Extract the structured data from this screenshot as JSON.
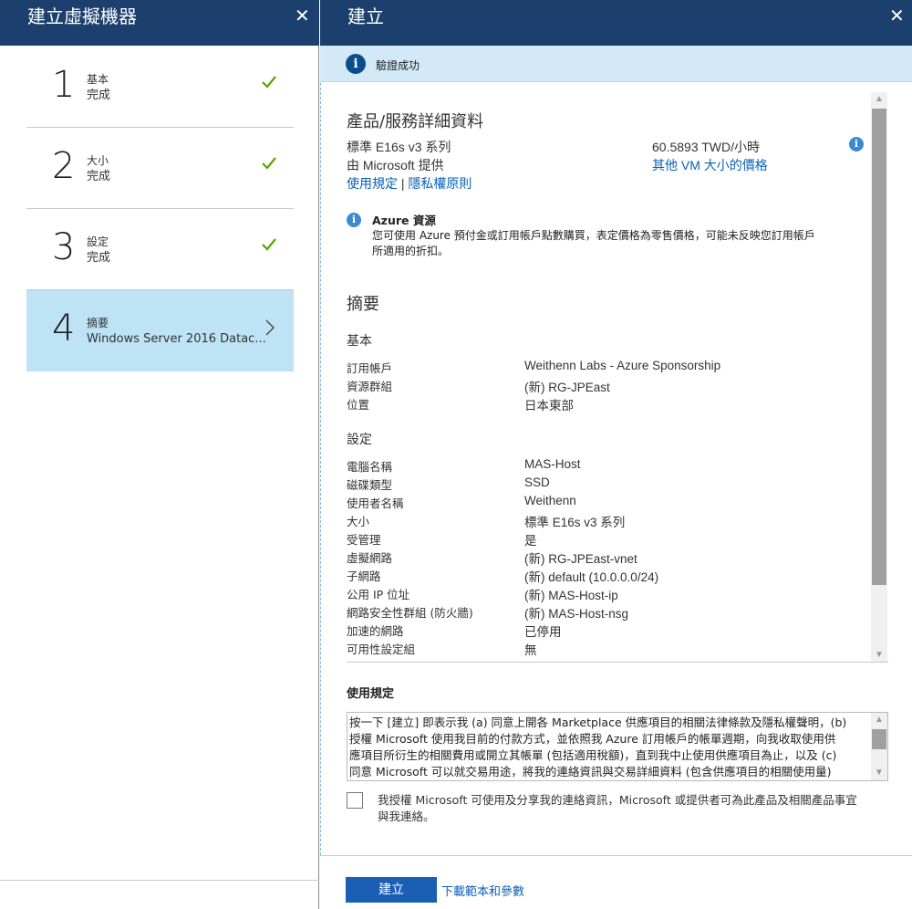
{
  "left": {
    "title": "建立虛擬機器",
    "close": "✕",
    "steps": [
      {
        "number": "1",
        "name": "基本",
        "status": "完成",
        "state": "done"
      },
      {
        "number": "2",
        "name": "大小",
        "status": "完成",
        "state": "done"
      },
      {
        "number": "3",
        "name": "設定",
        "status": "完成",
        "state": "done"
      },
      {
        "number": "4",
        "name": "摘要",
        "status": "Windows Server 2016 Datac...",
        "state": "active"
      }
    ]
  },
  "right": {
    "title": "建立",
    "close": "✕",
    "banner": {
      "icon": "info-icon",
      "text": "驗證成功"
    },
    "product": {
      "heading": "產品/服務詳細資料",
      "sku": "標準 E16s v3 系列",
      "provider": "由 Microsoft 提供",
      "terms_link": "使用規定",
      "separator": "|",
      "privacy_link": "隱私權原則",
      "price": "60.5893 TWD/小時",
      "pricing_link": "其他 VM 大小的價格"
    },
    "azure_note": {
      "title": "Azure 資源",
      "line1": "您可使用 Azure 預付金或訂用帳戶點數購買，表定價格為零售價格，可能未反映您訂用帳戶",
      "line2": "所適用的折扣。"
    },
    "summary": {
      "heading": "摘要",
      "basic": {
        "title": "基本",
        "rows": [
          {
            "label": "訂用帳戶",
            "value": "Weithenn Labs - Azure Sponsorship"
          },
          {
            "label": "資源群組",
            "value": "(新) RG-JPEast"
          },
          {
            "label": "位置",
            "value": "日本東部"
          }
        ]
      },
      "settings": {
        "title": "設定",
        "rows": [
          {
            "label": "電腦名稱",
            "value": "MAS-Host"
          },
          {
            "label": "磁碟類型",
            "value": "SSD"
          },
          {
            "label": "使用者名稱",
            "value": "Weithenn"
          },
          {
            "label": "大小",
            "value": "標準 E16s v3 系列"
          },
          {
            "label": "受管理",
            "value": "是"
          },
          {
            "label": "虛擬網路",
            "value": "(新) RG-JPEast-vnet"
          },
          {
            "label": "子網路",
            "value": "(新) default (10.0.0.0/24)"
          },
          {
            "label": "公用 IP 位址",
            "value": "(新) MAS-Host-ip"
          },
          {
            "label": "網路安全性群組 (防火牆)",
            "value": "(新) MAS-Host-nsg"
          },
          {
            "label": "加速的網路",
            "value": "已停用"
          },
          {
            "label": "可用性設定組",
            "value": "無"
          }
        ]
      }
    },
    "terms": {
      "title": "使用規定",
      "line1": "按一下 [建立] 即表示我 (a) 同意上開各 Marketplace 供應項目的相關法律條款及隱私權聲明，(b)",
      "line2": "授權 Microsoft 使用我目前的付款方式，並依照我 Azure 訂用帳戶的帳單週期，向我收取使用供",
      "line3": "應項目所衍生的相關費用或開立其帳單 (包括適用稅額)，直到我中止使用供應項目為止，以及 (c)",
      "line4": "同意 Microsoft 可以就交易用途，將我的連絡資訊與交易詳細資料 (包含供應項目的相關使用量)"
    },
    "consent": {
      "line1": "我授權 Microsoft 可使用及分享我的連絡資訊，Microsoft 或提供者可為此產品及相關產品事宜",
      "line2": "與我連絡。"
    },
    "create_button": "建立",
    "download_link": "下載範本和參數"
  },
  "colors": {
    "header": "#1c3f6e",
    "accent": "#1a5fb4",
    "check": "#57a300",
    "active_step": "#bde3f5",
    "banner": "#d3e9f8"
  }
}
